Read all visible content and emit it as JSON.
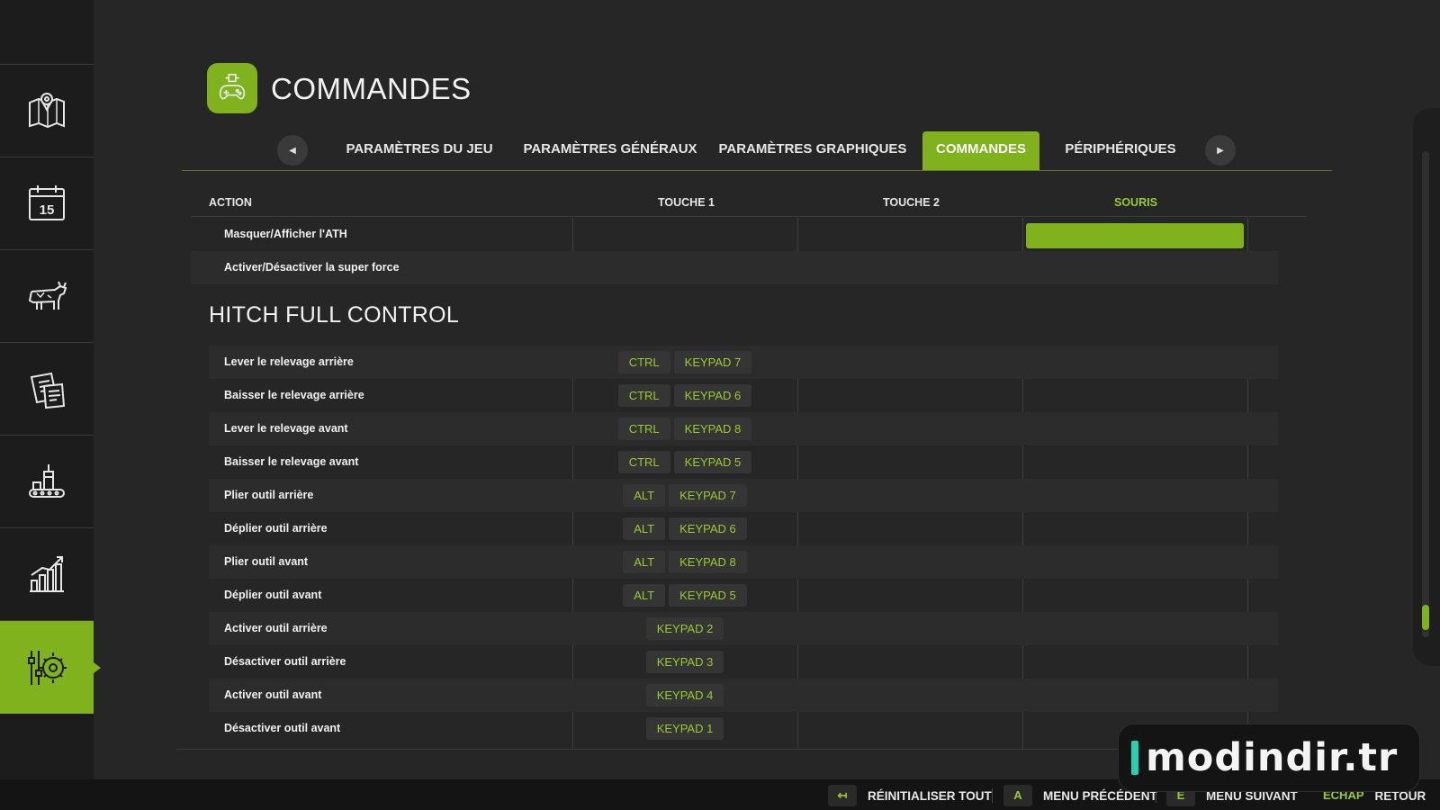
{
  "header": {
    "title": "COMMANDES",
    "icon": "gamepad-icon"
  },
  "sidebar": {
    "items": [
      {
        "name": "map",
        "icon": "map-icon",
        "active": false
      },
      {
        "name": "calendar",
        "icon": "calendar-icon",
        "label": "15",
        "active": false
      },
      {
        "name": "animals",
        "icon": "cow-icon",
        "active": false
      },
      {
        "name": "contracts",
        "icon": "documents-icon",
        "active": false
      },
      {
        "name": "production",
        "icon": "production-icon",
        "active": false
      },
      {
        "name": "statistics",
        "icon": "chart-icon",
        "active": false
      },
      {
        "name": "settings",
        "icon": "settings-icon",
        "active": true
      }
    ]
  },
  "tabs": {
    "prev_icon": "arrow-left-icon",
    "next_icon": "arrow-right-icon",
    "items": [
      {
        "label": "PARAMÈTRES DU JEU",
        "active": false
      },
      {
        "label": "PARAMÈTRES GÉNÉRAUX",
        "active": false
      },
      {
        "label": "PARAMÈTRES GRAPHIQUES",
        "active": false
      },
      {
        "label": "COMMANDES",
        "active": true
      },
      {
        "label": "PÉRIPHÉRIQUES",
        "active": false
      }
    ]
  },
  "table": {
    "columns": {
      "action": "ACTION",
      "key1": "TOUCHE 1",
      "key2": "TOUCHE 2",
      "mouse": "SOURIS"
    },
    "top_rows": [
      {
        "label": "Masquer/Afficher l'ATH",
        "key1": [],
        "mouse_selected": true
      },
      {
        "label": "Activer/Désactiver la super force",
        "key1": []
      }
    ],
    "section_title": "HITCH FULL CONTROL",
    "section_rows": [
      {
        "label": "Lever le relevage arrière",
        "key1": [
          "CTRL",
          "KEYPAD 7"
        ]
      },
      {
        "label": "Baisser le relevage arrière",
        "key1": [
          "CTRL",
          "KEYPAD 6"
        ]
      },
      {
        "label": "Lever le relevage avant",
        "key1": [
          "CTRL",
          "KEYPAD 8"
        ]
      },
      {
        "label": "Baisser le relevage avant",
        "key1": [
          "CTRL",
          "KEYPAD 5"
        ]
      },
      {
        "label": "Plier outil arrière",
        "key1": [
          "ALT",
          "KEYPAD 7"
        ]
      },
      {
        "label": "Déplier outil arrière",
        "key1": [
          "ALT",
          "KEYPAD 6"
        ]
      },
      {
        "label": "Plier outil avant",
        "key1": [
          "ALT",
          "KEYPAD 8"
        ]
      },
      {
        "label": "Déplier outil avant",
        "key1": [
          "ALT",
          "KEYPAD 5"
        ]
      },
      {
        "label": "Activer outil arrière",
        "key1": [
          "KEYPAD 2"
        ]
      },
      {
        "label": "Désactiver outil arrière",
        "key1": [
          "KEYPAD 3"
        ]
      },
      {
        "label": "Activer outil avant",
        "key1": [
          "KEYPAD 4"
        ]
      },
      {
        "label": "Désactiver outil avant",
        "key1": [
          "KEYPAD 1"
        ]
      }
    ]
  },
  "footer": {
    "reset": {
      "key": "↤",
      "label": "RÉINITIALISER TOUT"
    },
    "prev_menu": {
      "key": "A",
      "label": "MENU PRÉCÉDENT"
    },
    "next_menu": {
      "key": "E",
      "label": "MENU SUIVANT"
    },
    "back": {
      "key": "ECHAP",
      "label": "RETOUR"
    }
  },
  "watermark": {
    "text": "modindir.tr"
  },
  "colors": {
    "accent": "#7fb21d",
    "accent_text": "#9acb2c",
    "background": "#262626",
    "sidebar": "#1c1c1c"
  }
}
